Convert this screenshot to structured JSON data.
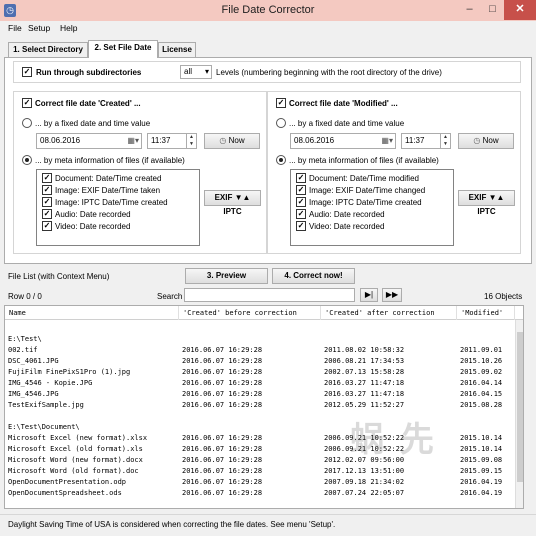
{
  "window": {
    "title": "File Date Corrector",
    "icon": "clock-icon"
  },
  "menu": [
    "File",
    "Setup",
    "Help"
  ],
  "tabs": [
    "1. Select Directory",
    "2. Set File Date",
    "License"
  ],
  "subdirs": {
    "label": "Run through subdirectories",
    "level_value": "all",
    "levels_text": "Levels  (numbering beginning with the root directory of the drive)"
  },
  "created": {
    "title": "Correct file date 'Created' ...",
    "fixed_label": "... by a fixed date and time value",
    "date": "08.06.2016",
    "time": "11:37",
    "now": "Now",
    "meta_label": "... by meta information of files (if available)",
    "items": [
      "Document: Date/Time created",
      "Image: EXIF Date/Time taken",
      "Image: IPTC Date/Time created",
      "Audio: Date recorded",
      "Video: Date recorded"
    ],
    "exif_btn": "EXIF ▼▲ IPTC"
  },
  "modified": {
    "title": "Correct file date 'Modified' ...",
    "fixed_label": "... by a fixed date and time value",
    "date": "08.06.2016",
    "time": "11:37",
    "now": "Now",
    "meta_label": "... by meta information of files (if available)",
    "items": [
      "Document: Date/Time modified",
      "Image: EXIF Date/Time changed",
      "Image: IPTC Date/Time created",
      "Audio: Date recorded",
      "Video: Date recorded"
    ],
    "exif_btn": "EXIF ▼▲ IPTC"
  },
  "actions": {
    "file_list_label": "File List (with Context Menu)",
    "preview": "3. Preview",
    "correct": "4. Correct now!"
  },
  "search": {
    "row_label": "Row 0 / 0",
    "label": "Search",
    "value": "",
    "count": "16 Objects"
  },
  "table": {
    "columns": [
      "Name",
      "'Created' before correction",
      "'Created' after correction",
      "'Modified'"
    ],
    "rows": [
      {
        "type": "blank"
      },
      {
        "type": "group",
        "name": "E:\\Test\\"
      },
      {
        "name": "002.tif",
        "before": "2016.06.07 16:29:28",
        "after": "2011.08.02 10:58:32",
        "mod": "2011.09.01"
      },
      {
        "name": "DSC_4061.JPG",
        "before": "2016.06.07 16:29:28",
        "after": "2006.08.21 17:34:53",
        "mod": "2015.10.26"
      },
      {
        "name": "FujiFilm FinePixS1Pro (1).jpg",
        "before": "2016.06.07 16:29:28",
        "after": "2002.07.13 15:58:28",
        "mod": "2015.09.02"
      },
      {
        "name": "IMG_4546 - Kopie.JPG",
        "before": "2016.06.07 16:29:28",
        "after": "2016.03.27 11:47:18",
        "mod": "2016.04.14"
      },
      {
        "name": "IMG_4546.JPG",
        "before": "2016.06.07 16:29:28",
        "after": "2016.03.27 11:47:18",
        "mod": "2016.04.15"
      },
      {
        "name": "TestExifSample.jpg",
        "before": "2016.06.07 16:29:28",
        "after": "2012.05.29 11:52:27",
        "mod": "2015.08.28"
      },
      {
        "type": "blank"
      },
      {
        "type": "group",
        "name": "E:\\Test\\Document\\"
      },
      {
        "name": "Microsoft Excel (new format).xlsx",
        "before": "2016.06.07 16:29:28",
        "after": "2006.09.21 10:52:22",
        "mod": "2015.10.14"
      },
      {
        "name": "Microsoft Excel (old format).xls",
        "before": "2016.06.07 16:29:28",
        "after": "2006.09.21 10:52:22",
        "mod": "2015.10.14"
      },
      {
        "name": "Microsoft Word (new format).docx",
        "before": "2016.06.07 16:29:28",
        "after": "2012.02.07 09:56:00",
        "mod": "2015.09.08"
      },
      {
        "name": "Microsoft Word (old format).doc",
        "before": "2016.06.07 16:29:28",
        "after": "2017.12.13 13:51:00",
        "mod": "2015.09.15"
      },
      {
        "name": "OpenDocumentPresentation.odp",
        "before": "2016.06.07 16:29:28",
        "after": "2007.09.18 21:34:02",
        "mod": "2016.04.19"
      },
      {
        "name": "OpenDocumentSpreadsheet.ods",
        "before": "2016.06.07 16:29:28",
        "after": "2007.07.24 22:05:07",
        "mod": "2016.04.19"
      }
    ]
  },
  "status": "Daylight Saving Time of USA is considered when correcting the file dates. See menu 'Setup'.",
  "colors": {
    "titlebar": "#f4c9c1",
    "close": "#c7504a",
    "window_bg": "#f0f0f0"
  }
}
